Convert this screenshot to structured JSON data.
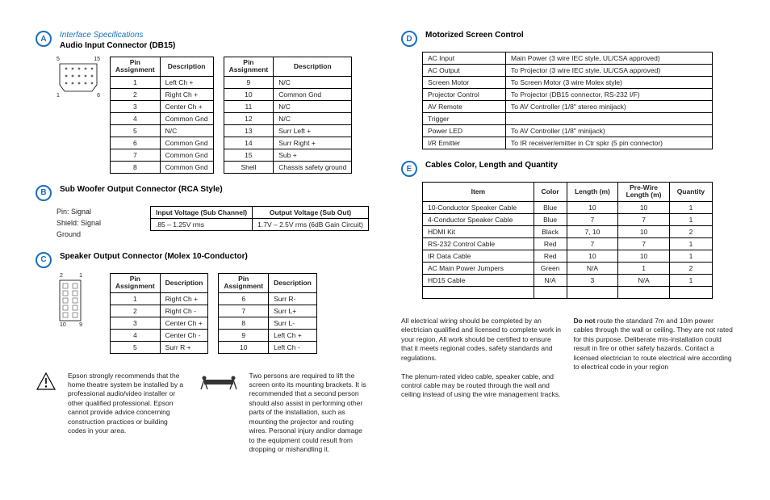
{
  "A": {
    "interface": "Interface Specifications",
    "title": "Audio Input Connector (DB15)",
    "labels": {
      "top_left": "5",
      "top_right": "15",
      "bot_left": "1",
      "bot_right": "6"
    },
    "head": [
      "Pin Assignment",
      "Description"
    ],
    "left": [
      [
        "1",
        "Left Ch +"
      ],
      [
        "2",
        "Right Ch +"
      ],
      [
        "3",
        "Center Ch +"
      ],
      [
        "4",
        "Common Gnd"
      ],
      [
        "5",
        "N/C"
      ],
      [
        "6",
        "Common Gnd"
      ],
      [
        "7",
        "Common Gnd"
      ],
      [
        "8",
        "Common Gnd"
      ]
    ],
    "right": [
      [
        "9",
        "N/C"
      ],
      [
        "10",
        "Common Gnd"
      ],
      [
        "11",
        "N/C"
      ],
      [
        "12",
        "N/C"
      ],
      [
        "13",
        "Surr Left +"
      ],
      [
        "14",
        "Surr Right +"
      ],
      [
        "15",
        "Sub +"
      ],
      [
        "Shell",
        "Chassis safety ground"
      ]
    ]
  },
  "B": {
    "title": "Sub Woofer Output Connector (RCA Style)",
    "pin": "Pin:  Signal",
    "shield": "Shield:  Signal Ground",
    "head": [
      "Input Voltage (Sub Channel)",
      "Output Voltage (Sub Out)"
    ],
    "row": [
      ".85 – 1.25V rms",
      "1.7V – 2.5V rms (6dB Gain Circuit)"
    ]
  },
  "C": {
    "title": "Speaker Output Connector (Molex 10-Conductor)",
    "labels": {
      "tl": "2",
      "tr": "1",
      "bl": "10",
      "br": "9"
    },
    "head": [
      "Pin Assignment",
      "Description"
    ],
    "left": [
      [
        "1",
        "Right Ch +"
      ],
      [
        "2",
        "Right Ch -"
      ],
      [
        "3",
        "Center Ch +"
      ],
      [
        "4",
        "Center Ch -"
      ],
      [
        "5",
        "Surr R +"
      ]
    ],
    "right": [
      [
        "6",
        "Surr R-"
      ],
      [
        "7",
        "Surr L+"
      ],
      [
        "8",
        "Surr L-"
      ],
      [
        "9",
        "Left Ch +"
      ],
      [
        "10",
        "Left Ch -"
      ]
    ]
  },
  "D": {
    "title": "Motorized Screen Control",
    "rows": [
      [
        "AC Input",
        "Main Power (3 wire IEC style, UL/CSA approved)"
      ],
      [
        "AC Output",
        "To Projector (3 wire IEC style, UL/CSA approved)"
      ],
      [
        "Screen Motor",
        "To Screen Motor (3 wire Molex style)"
      ],
      [
        "Projector Control",
        "To Projector (DB15 connector, RS-232 I/F)"
      ],
      [
        "AV Remote",
        "To AV Controller (1/8\" stereo minijack)"
      ],
      [
        "Trigger",
        ""
      ],
      [
        "Power LED",
        "To AV Controller (1/8\" minijack)"
      ],
      [
        "I/R Emitter",
        "To IR receiver/emitter in Ctr spkr (5 pin connector)"
      ]
    ]
  },
  "E": {
    "title": "Cables Color, Length and Quantity",
    "head": [
      "Item",
      "Color",
      "Length (m)",
      "Pre-Wire Length (m)",
      "Quantity"
    ],
    "rows": [
      [
        "10-Conductor Speaker Cable",
        "Blue",
        "10",
        "10",
        "1"
      ],
      [
        "4-Conductor Speaker Cable",
        "Blue",
        "7",
        "7",
        "1"
      ],
      [
        "HDMI Kit",
        "Black",
        "7, 10",
        "10",
        "2"
      ],
      [
        "RS-232 Control Cable",
        "Red",
        "7",
        "7",
        "1"
      ],
      [
        "IR Data Cable",
        "Red",
        "10",
        "10",
        "1"
      ],
      [
        "AC Main Power Jumpers",
        "Green",
        "N/A",
        "1",
        "2"
      ],
      [
        "HD15 Cable",
        "N/A",
        "3",
        "N/A",
        "1"
      ],
      [
        "",
        "",
        "",
        "",
        ""
      ]
    ]
  },
  "warn": {
    "p1": "Epson strongly recommends that the home theatre system be installed by a professional audio/video installer or other qualified professional. Epson cannot provide advice concerning construction practices or building codes in your area.",
    "p2": "Two persons are required to lift the screen onto its mounting brackets. It is recommended that a second person should also assist in performing other parts of the installation, such as mounting the projector and routing wires. Personal injury and/or damage to the equipment could result from dropping or mishandling it.",
    "p3": "All electrical wiring should be completed by an electrician qualified and licensed to complete work in your region. All work should be certified to ensure that it meets regional codes, safety standards and regulations.",
    "p3b": "The plenum-rated video cable, speaker cable, and control cable may be routed through the wall and ceiling instead of using the wire management tracks.",
    "p4a": "Do not",
    "p4b": " route the standard 7m and 10m power cables through the wall or ceiling. They are not rated for this purpose. Deliberate mis-installation could result in fire or other safety hazards. Contact a licensed electrician to route electrical wire according to electrical code in your region"
  }
}
